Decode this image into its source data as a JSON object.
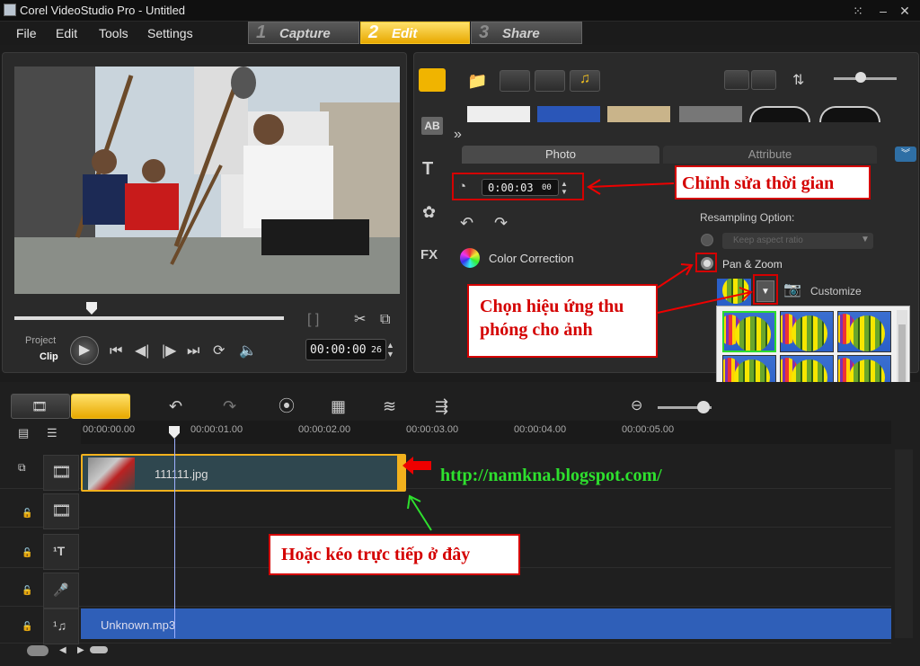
{
  "window": {
    "title": "Corel VideoStudio Pro - Untitled"
  },
  "menu": [
    "File",
    "Edit",
    "Tools",
    "Settings"
  ],
  "steps": [
    {
      "num": "1",
      "label": "Capture"
    },
    {
      "num": "2",
      "label": "Edit"
    },
    {
      "num": "3",
      "label": "Share"
    }
  ],
  "player": {
    "mode_project": "Project",
    "mode_clip": "Clip",
    "timecode": "00:00:00",
    "timecode_frames": "26",
    "trim_brackets": "[   ]"
  },
  "options": {
    "tab_photo": "Photo",
    "tab_attribute": "Attribute",
    "duration": "0:00:03",
    "duration_frames": "00",
    "color_correction": "Color Correction",
    "resampling_label": "Resampling Option:",
    "resampling_select": "Keep aspect ratio",
    "pan_zoom": "Pan & Zoom",
    "customize": "Customize"
  },
  "annotations": {
    "duration_note": "Chỉnh sửa thời gian",
    "effect_note": "Chọn hiệu ứng thu phóng cho ảnh",
    "drag_note": "Hoặc kéo trực tiếp ở đây",
    "url": "http://namkna.blogspot.com/"
  },
  "timeline": {
    "ruler": [
      "00:00:00.00",
      "00:00:01.00",
      "00:00:02.00",
      "00:00:03.00",
      "00:00:04.00",
      "00:00:05.00"
    ],
    "clip_name": "111111.jpg",
    "audio_name": "Unknown.mp3"
  }
}
